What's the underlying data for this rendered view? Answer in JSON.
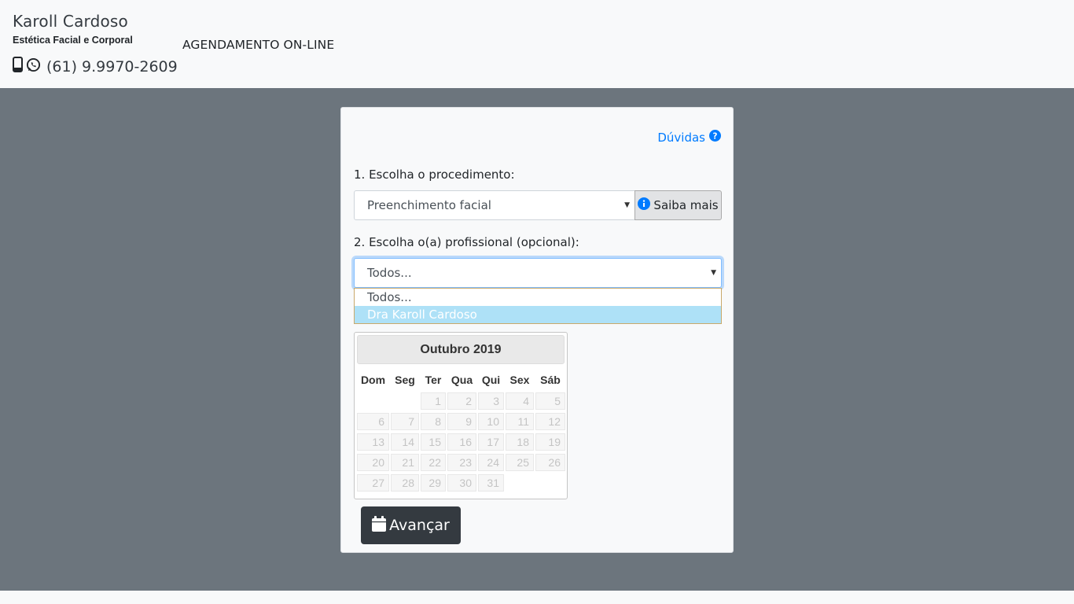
{
  "header": {
    "brand_name": "Karoll Cardoso",
    "brand_subtitle": "Estética Facial e Corporal",
    "phone": "(61) 9.9970-2609",
    "nav_link": "AGENDAMENTO ON-LINE"
  },
  "form": {
    "help_label": "Dúvidas",
    "step1_label": "1. Escolha o procedimento:",
    "procedure_value": "Preenchimento facial",
    "saiba_mais_label": "Saiba mais",
    "step2_label": "2. Escolha o(a) profissional (opcional):",
    "professional_value": "Todos...",
    "professional_options": [
      "Todos...",
      "Dra Karoll Cardoso"
    ],
    "professional_highlighted": "Dra Karoll Cardoso",
    "advance_label": "Avançar"
  },
  "calendar": {
    "month_title": "Outubro 2019",
    "weekdays": [
      "Dom",
      "Seg",
      "Ter",
      "Qua",
      "Qui",
      "Sex",
      "Sáb"
    ],
    "first_weekday_index": 2,
    "days": [
      1,
      2,
      3,
      4,
      5,
      6,
      7,
      8,
      9,
      10,
      11,
      12,
      13,
      14,
      15,
      16,
      17,
      18,
      19,
      20,
      21,
      22,
      23,
      24,
      25,
      26,
      27,
      28,
      29,
      30,
      31
    ],
    "days_disabled": true
  },
  "colors": {
    "background_main": "#6c757d",
    "link": "#007bff",
    "button_dark": "#343a40",
    "dropdown_highlight": "#aee1f7"
  },
  "icons": {
    "phone": "mobile-phone-icon",
    "whatsapp": "whatsapp-icon",
    "help": "question-circle-icon",
    "info": "info-circle-icon",
    "calendar": "calendar-icon",
    "caret": "caret-down-icon"
  }
}
